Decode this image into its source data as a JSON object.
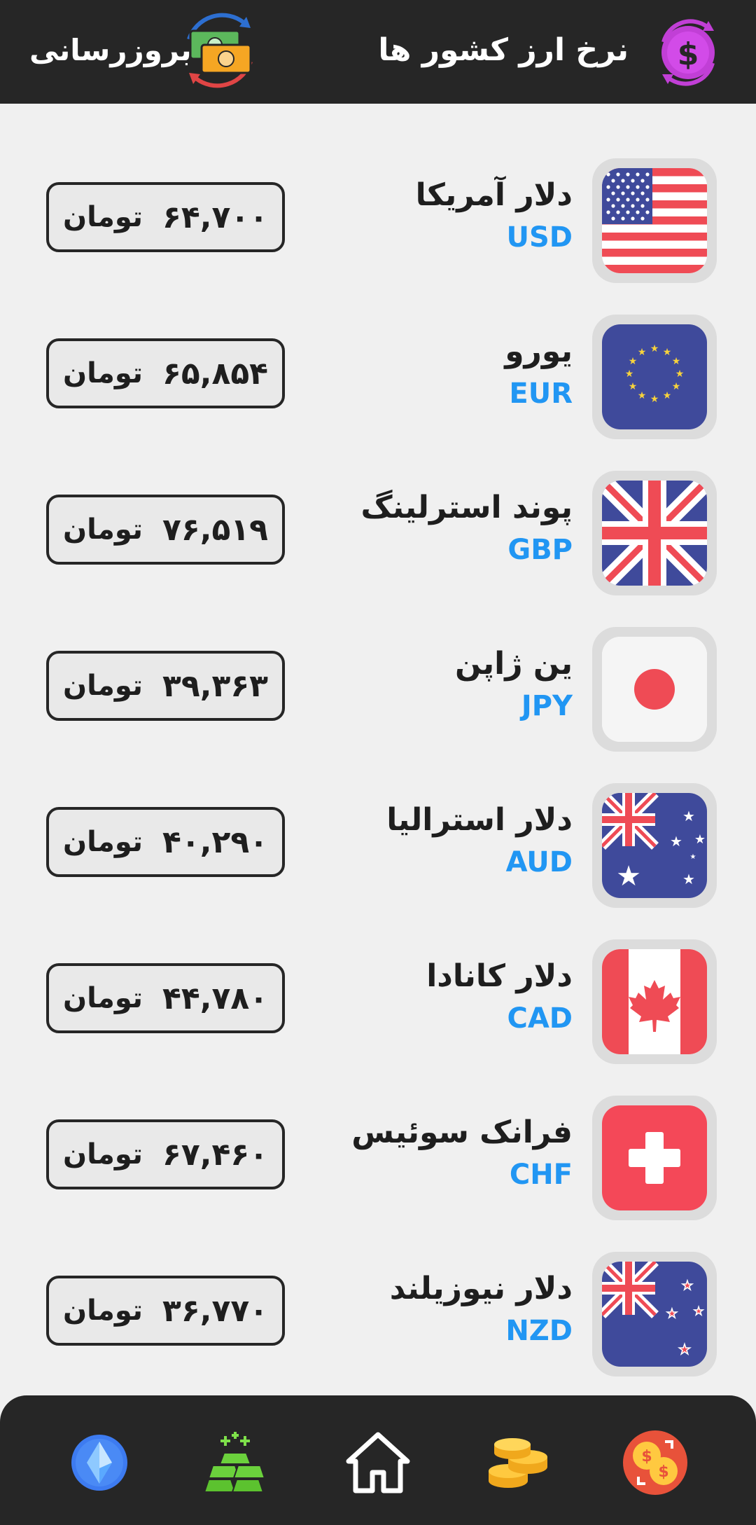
{
  "header": {
    "title": "نرخ ارز کشور ها",
    "refresh_label": "بروزرسانی",
    "logo_icon": "dollar-exchange-icon",
    "refresh_icon": "money-refresh-icon"
  },
  "currencies": [
    {
      "name": "دلار آمریکا",
      "code": "USD",
      "price": "۶۴,۷۰۰",
      "unit": "تومان",
      "flag": "us-flag-icon"
    },
    {
      "name": "یورو",
      "code": "EUR",
      "price": "۶۵,۸۵۴",
      "unit": "تومان",
      "flag": "eu-flag-icon"
    },
    {
      "name": "پوند استرلینگ",
      "code": "GBP",
      "price": "۷۶,۵۱۹",
      "unit": "تومان",
      "flag": "uk-flag-icon"
    },
    {
      "name": "ین ژاپن",
      "code": "JPY",
      "price": "۳۹,۳۶۳",
      "unit": "تومان",
      "flag": "japan-flag-icon"
    },
    {
      "name": "دلار استرالیا",
      "code": "AUD",
      "price": "۴۰,۲۹۰",
      "unit": "تومان",
      "flag": "australia-flag-icon"
    },
    {
      "name": "دلار کانادا",
      "code": "CAD",
      "price": "۴۴,۷۸۰",
      "unit": "تومان",
      "flag": "canada-flag-icon"
    },
    {
      "name": "فرانک سوئیس",
      "code": "CHF",
      "price": "۶۷,۴۶۰",
      "unit": "تومان",
      "flag": "switzerland-flag-icon"
    },
    {
      "name": "دلار نیوزیلند",
      "code": "NZD",
      "price": "۳۶,۷۷۰",
      "unit": "تومان",
      "flag": "new-zealand-flag-icon"
    }
  ],
  "bottom_nav": [
    {
      "icon": "crypto-diamond-icon"
    },
    {
      "icon": "gold-bars-icon"
    },
    {
      "icon": "home-icon"
    },
    {
      "icon": "gold-coins-icon"
    },
    {
      "icon": "currency-exchange-icon"
    }
  ],
  "colors": {
    "header_bg": "#262626",
    "page_bg": "#f0f0f0",
    "code_blue": "#2196f3",
    "nav_bg": "#262626"
  }
}
